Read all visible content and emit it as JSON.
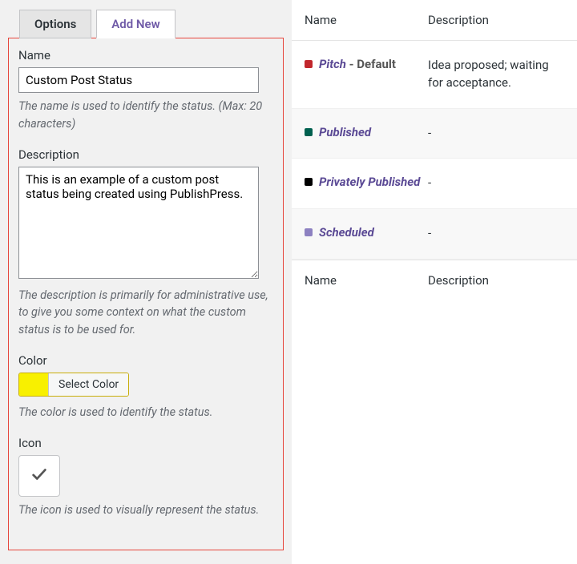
{
  "tabs": {
    "options": "Options",
    "addnew": "Add New"
  },
  "form": {
    "name_label": "Name",
    "name_value": "Custom Post Status",
    "name_hint": "The name is used to identify the status. (Max: 20 characters)",
    "desc_label": "Description",
    "desc_value": "This is an example of a custom post status being created using PublishPress.",
    "desc_hint": "The description is primarily for administrative use, to give you some context on what the custom status is to be used for.",
    "color_label": "Color",
    "color_button": "Select Color",
    "color_value": "#f8f000",
    "color_hint": "The color is used to identify the status.",
    "icon_label": "Icon",
    "icon_hint": "The icon is used to visually represent the status."
  },
  "table": {
    "headers": {
      "name": "Name",
      "desc": "Description"
    },
    "rows": [
      {
        "color": "#c1272d",
        "name": "Pitch",
        "default": " - Default",
        "desc": "Idea proposed; waiting for acceptance."
      },
      {
        "color": "#00604f",
        "name": "Published",
        "default": "",
        "desc": "-"
      },
      {
        "color": "#000000",
        "name": "Privately Published",
        "default": "",
        "desc": "-"
      },
      {
        "color": "#8d81c1",
        "name": "Scheduled",
        "default": "",
        "desc": "-"
      }
    ]
  }
}
